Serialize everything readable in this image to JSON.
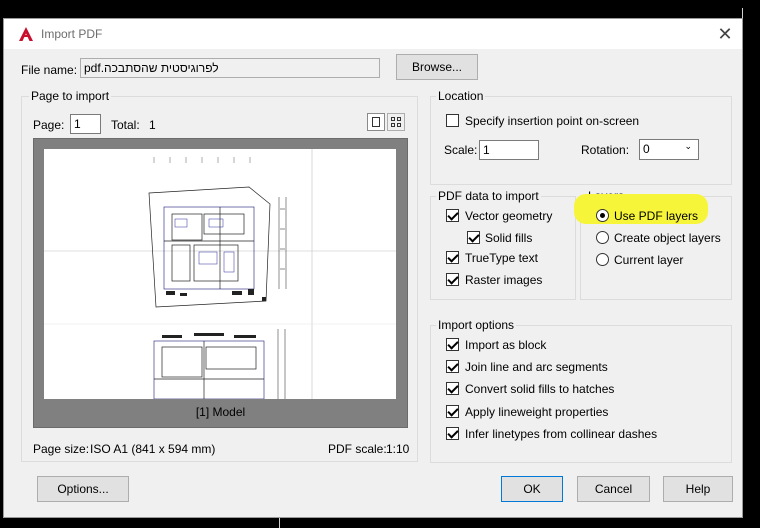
{
  "dialog": {
    "title": "Import PDF",
    "close_glyph": "✕",
    "app_icon": "autocad-a-icon"
  },
  "file": {
    "label": "File name:",
    "value": "לפרוגיסטית שהסתבכה.pdf",
    "browse": "Browse..."
  },
  "page_to_import": {
    "title": "Page to import",
    "page_label": "Page:",
    "page_value": "1",
    "total_label": "Total:",
    "total_value": "1",
    "preview_caption": "[1] Model",
    "page_size_label": "Page size:",
    "page_size_value": "ISO A1 (841 x 594 mm)",
    "pdf_scale_label": "PDF scale:",
    "pdf_scale_value": "1:10"
  },
  "location": {
    "title": "Location",
    "specify_label": "Specify insertion point on-screen",
    "specify_checked": false,
    "scale_label": "Scale:",
    "scale_value": "1",
    "rotation_label": "Rotation:",
    "rotation_value": "0"
  },
  "pdf_data": {
    "title": "PDF data to import",
    "items": [
      {
        "label": "Vector geometry",
        "checked": true
      },
      {
        "label": "Solid fills",
        "checked": true
      },
      {
        "label": "TrueType text",
        "checked": true
      },
      {
        "label": "Raster images",
        "checked": true
      }
    ]
  },
  "layers": {
    "title": "Layers",
    "options": [
      {
        "label": "Use PDF layers",
        "selected": true
      },
      {
        "label": "Create object layers",
        "selected": false
      },
      {
        "label": "Current layer",
        "selected": false
      }
    ],
    "highlight_color": "#f7f53a"
  },
  "import_options": {
    "title": "Import options",
    "items": [
      {
        "label": "Import as block",
        "checked": true
      },
      {
        "label": "Join line and arc segments",
        "checked": true
      },
      {
        "label": "Convert solid fills to hatches",
        "checked": true
      },
      {
        "label": "Apply lineweight properties",
        "checked": true
      },
      {
        "label": "Infer linetypes from collinear dashes",
        "checked": true
      }
    ]
  },
  "buttons": {
    "options": "Options...",
    "ok": "OK",
    "cancel": "Cancel",
    "help": "Help"
  },
  "colors": {
    "accent": "#0078d7",
    "app_icon_red": "#c8102e"
  }
}
